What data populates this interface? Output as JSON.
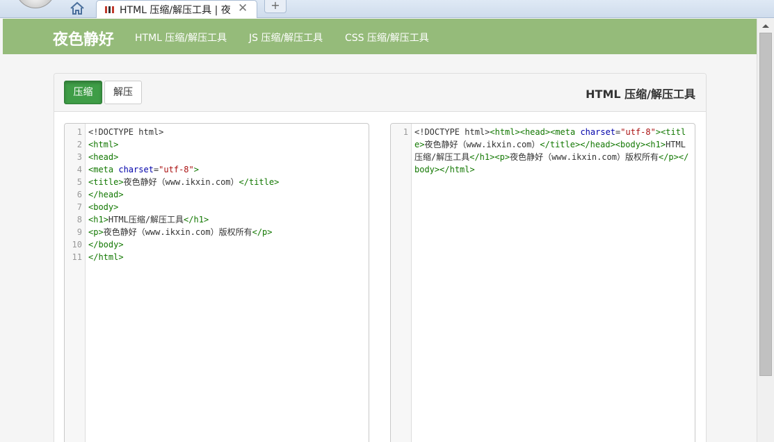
{
  "browser": {
    "tab_title": "HTML 压缩/解压工具 | 夜",
    "tab_close": "✕",
    "new_tab": "+"
  },
  "navbar": {
    "brand": "夜色静好",
    "links": [
      "HTML 压缩/解压工具",
      "JS 压缩/解压工具",
      "CSS 压缩/解压工具"
    ],
    "bg_color": "#95bb7a"
  },
  "panel": {
    "compress_label": "压缩",
    "decompress_label": "解压",
    "title": "HTML 压缩/解压工具",
    "active_button_color": "#3f9d47"
  },
  "input_editor": {
    "line_numbers": [
      "1",
      "2",
      "3",
      "4",
      "5",
      "6",
      "7",
      "8",
      "9",
      "10",
      "11"
    ],
    "lines": [
      "<!DOCTYPE html>",
      "<html>",
      "<head>",
      "<meta charset=\"utf-8\">",
      "<title>夜色静好（www.ikxin.com）</title>",
      "</head>",
      "<body>",
      "<h1>HTML压缩/解压工具</h1>",
      "<p>夜色静好（www.ikxin.com）版权所有</p>",
      "</body>",
      "</html>"
    ]
  },
  "output_editor": {
    "line_numbers": [
      "1"
    ],
    "lines": [
      "<!DOCTYPE html><html><head><meta charset=\"utf-8\"><title>夜色静好（www.ikxin.com）</title></head><body><h1>HTML压缩/解压工具</h1><p>夜色静好（www.ikxin.com）版权所有</p></body></html>"
    ]
  }
}
